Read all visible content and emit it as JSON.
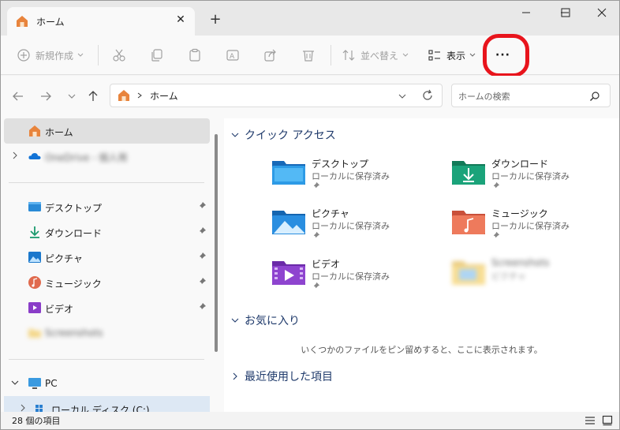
{
  "window": {
    "tab_title": "ホーム",
    "new_tab": "+",
    "close_tab": "✕"
  },
  "toolbar": {
    "new_label": "新規作成",
    "sort_label": "並べ替え",
    "view_label": "表示",
    "more_label": "···"
  },
  "address": {
    "crumb": "ホーム",
    "search_placeholder": "ホームの検索"
  },
  "sidebar": {
    "home": "ホーム",
    "onedrive": "OneDrive - 個人用",
    "pinned": [
      {
        "label": "デスクトップ",
        "icon": "desktop-icon"
      },
      {
        "label": "ダウンロード",
        "icon": "download-icon"
      },
      {
        "label": "ピクチャ",
        "icon": "pictures-icon"
      },
      {
        "label": "ミュージック",
        "icon": "music-icon"
      },
      {
        "label": "ビデオ",
        "icon": "videos-icon"
      },
      {
        "label": "Screenshots",
        "icon": "folder-icon"
      }
    ],
    "pc": "PC",
    "local_disk": "ローカル ディスク (C:)"
  },
  "main": {
    "quick_access_title": "クイック アクセス",
    "favorites_title": "お気に入り",
    "recent_title": "最近使用した項目",
    "favorites_empty": "いくつかのファイルをピン留めすると、ここに表示されます。",
    "quick_access": [
      {
        "name": "デスクトップ",
        "sub": "ローカルに保存済み"
      },
      {
        "name": "ダウンロード",
        "sub": "ローカルに保存済み"
      },
      {
        "name": "ピクチャ",
        "sub": "ローカルに保存済み"
      },
      {
        "name": "ミュージック",
        "sub": "ローカルに保存済み"
      },
      {
        "name": "ビデオ",
        "sub": "ローカルに保存済み"
      },
      {
        "name": "Screenshots",
        "sub": "ピクチャ"
      }
    ]
  },
  "status": {
    "count": "28 個の項目"
  },
  "colors": {
    "highlight_ring": "#e8141c",
    "accent": "#0067c0",
    "selected_bg": "#e0e0e0"
  }
}
